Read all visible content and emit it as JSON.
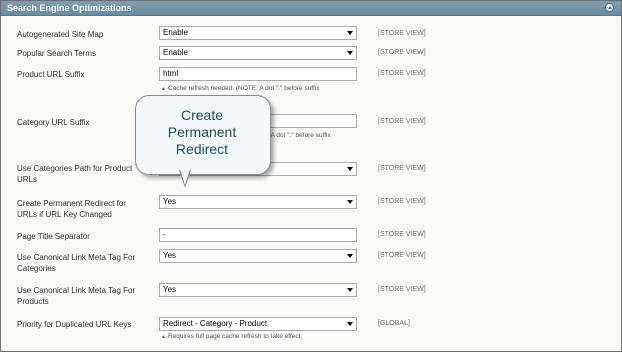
{
  "section": {
    "title": "Search Engine Optimizations"
  },
  "rows": [
    {
      "label": "Autogenerated Site Map",
      "value": "Enable",
      "scope": "[STORE VIEW]"
    },
    {
      "label": "Popular Search Terms",
      "value": "Enable",
      "scope": "[STORE VIEW]"
    },
    {
      "label": "Product URL Suffix",
      "value": "html",
      "scope": "[STORE VIEW]",
      "note": "Cache refresh needed. (NOTE: A dot \".\" before suffix"
    },
    {
      "label": "Category URL Suffix",
      "value": "",
      "scope": "[STORE VIEW]",
      "note": "E: A dot \".\" before suffix"
    },
    {
      "label_line1": "Use Categories Path for Product",
      "label_line2": "URLs",
      "value": "",
      "scope": "[STORE VIEW]"
    },
    {
      "label_line1": "Create Permanent Redirect for",
      "label_line2": "URLs if URL Key Changed",
      "value": "Yes",
      "scope": "[STORE VIEW]"
    },
    {
      "label": "Page Title Separator",
      "value": "-",
      "scope": "[STORE VIEW]"
    },
    {
      "label_line1": "Use Canonical Link Meta Tag For",
      "label_line2": "Categories",
      "value": "Yes",
      "scope": "[STORE VIEW]"
    },
    {
      "label_line1": "Use Canonical Link Meta Tag For",
      "label_line2": "Products",
      "value": "Yes",
      "scope": "[STORE VIEW]"
    },
    {
      "label": "Priority for Duplicated URL Keys",
      "value": "Redirect - Category - Product",
      "scope": "[GLOBAL]",
      "note": "Requires full page cache refresh to take effect."
    }
  ],
  "callout": {
    "line1": "Create",
    "line2": "Permanent",
    "line3": "Redirect"
  },
  "icons": {
    "collapse": "collapse-up-icon",
    "note": "triangle-up-icon",
    "dropdown": "chevron-down-icon"
  }
}
